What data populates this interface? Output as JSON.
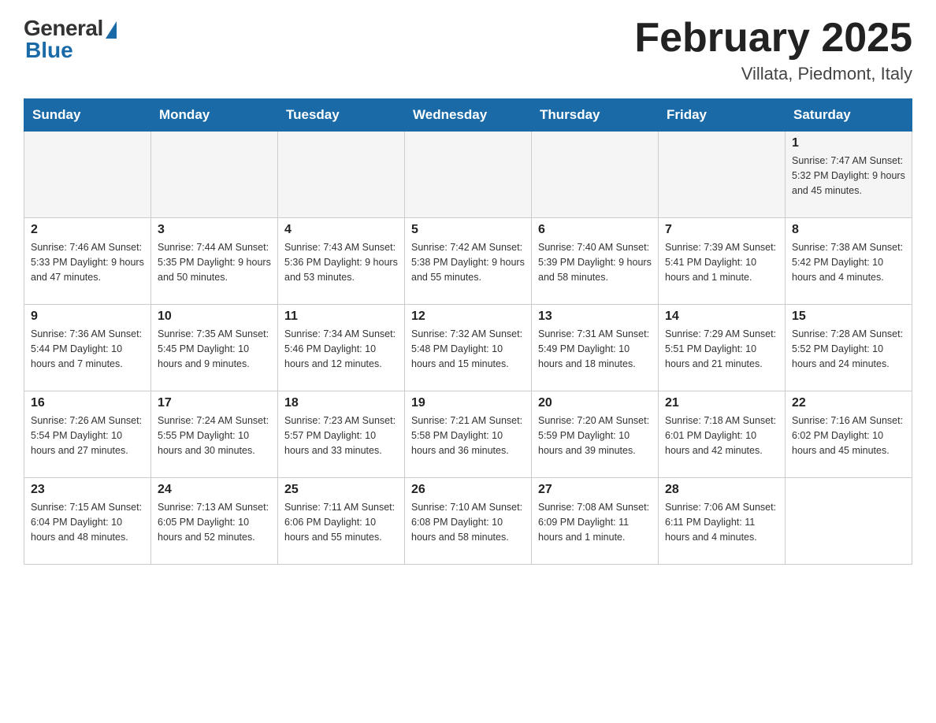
{
  "header": {
    "logo_general": "General",
    "logo_blue": "Blue",
    "month_title": "February 2025",
    "location": "Villata, Piedmont, Italy"
  },
  "weekdays": [
    "Sunday",
    "Monday",
    "Tuesday",
    "Wednesday",
    "Thursday",
    "Friday",
    "Saturday"
  ],
  "weeks": [
    [
      {
        "day": "",
        "info": ""
      },
      {
        "day": "",
        "info": ""
      },
      {
        "day": "",
        "info": ""
      },
      {
        "day": "",
        "info": ""
      },
      {
        "day": "",
        "info": ""
      },
      {
        "day": "",
        "info": ""
      },
      {
        "day": "1",
        "info": "Sunrise: 7:47 AM\nSunset: 5:32 PM\nDaylight: 9 hours and 45 minutes."
      }
    ],
    [
      {
        "day": "2",
        "info": "Sunrise: 7:46 AM\nSunset: 5:33 PM\nDaylight: 9 hours and 47 minutes."
      },
      {
        "day": "3",
        "info": "Sunrise: 7:44 AM\nSunset: 5:35 PM\nDaylight: 9 hours and 50 minutes."
      },
      {
        "day": "4",
        "info": "Sunrise: 7:43 AM\nSunset: 5:36 PM\nDaylight: 9 hours and 53 minutes."
      },
      {
        "day": "5",
        "info": "Sunrise: 7:42 AM\nSunset: 5:38 PM\nDaylight: 9 hours and 55 minutes."
      },
      {
        "day": "6",
        "info": "Sunrise: 7:40 AM\nSunset: 5:39 PM\nDaylight: 9 hours and 58 minutes."
      },
      {
        "day": "7",
        "info": "Sunrise: 7:39 AM\nSunset: 5:41 PM\nDaylight: 10 hours and 1 minute."
      },
      {
        "day": "8",
        "info": "Sunrise: 7:38 AM\nSunset: 5:42 PM\nDaylight: 10 hours and 4 minutes."
      }
    ],
    [
      {
        "day": "9",
        "info": "Sunrise: 7:36 AM\nSunset: 5:44 PM\nDaylight: 10 hours and 7 minutes."
      },
      {
        "day": "10",
        "info": "Sunrise: 7:35 AM\nSunset: 5:45 PM\nDaylight: 10 hours and 9 minutes."
      },
      {
        "day": "11",
        "info": "Sunrise: 7:34 AM\nSunset: 5:46 PM\nDaylight: 10 hours and 12 minutes."
      },
      {
        "day": "12",
        "info": "Sunrise: 7:32 AM\nSunset: 5:48 PM\nDaylight: 10 hours and 15 minutes."
      },
      {
        "day": "13",
        "info": "Sunrise: 7:31 AM\nSunset: 5:49 PM\nDaylight: 10 hours and 18 minutes."
      },
      {
        "day": "14",
        "info": "Sunrise: 7:29 AM\nSunset: 5:51 PM\nDaylight: 10 hours and 21 minutes."
      },
      {
        "day": "15",
        "info": "Sunrise: 7:28 AM\nSunset: 5:52 PM\nDaylight: 10 hours and 24 minutes."
      }
    ],
    [
      {
        "day": "16",
        "info": "Sunrise: 7:26 AM\nSunset: 5:54 PM\nDaylight: 10 hours and 27 minutes."
      },
      {
        "day": "17",
        "info": "Sunrise: 7:24 AM\nSunset: 5:55 PM\nDaylight: 10 hours and 30 minutes."
      },
      {
        "day": "18",
        "info": "Sunrise: 7:23 AM\nSunset: 5:57 PM\nDaylight: 10 hours and 33 minutes."
      },
      {
        "day": "19",
        "info": "Sunrise: 7:21 AM\nSunset: 5:58 PM\nDaylight: 10 hours and 36 minutes."
      },
      {
        "day": "20",
        "info": "Sunrise: 7:20 AM\nSunset: 5:59 PM\nDaylight: 10 hours and 39 minutes."
      },
      {
        "day": "21",
        "info": "Sunrise: 7:18 AM\nSunset: 6:01 PM\nDaylight: 10 hours and 42 minutes."
      },
      {
        "day": "22",
        "info": "Sunrise: 7:16 AM\nSunset: 6:02 PM\nDaylight: 10 hours and 45 minutes."
      }
    ],
    [
      {
        "day": "23",
        "info": "Sunrise: 7:15 AM\nSunset: 6:04 PM\nDaylight: 10 hours and 48 minutes."
      },
      {
        "day": "24",
        "info": "Sunrise: 7:13 AM\nSunset: 6:05 PM\nDaylight: 10 hours and 52 minutes."
      },
      {
        "day": "25",
        "info": "Sunrise: 7:11 AM\nSunset: 6:06 PM\nDaylight: 10 hours and 55 minutes."
      },
      {
        "day": "26",
        "info": "Sunrise: 7:10 AM\nSunset: 6:08 PM\nDaylight: 10 hours and 58 minutes."
      },
      {
        "day": "27",
        "info": "Sunrise: 7:08 AM\nSunset: 6:09 PM\nDaylight: 11 hours and 1 minute."
      },
      {
        "day": "28",
        "info": "Sunrise: 7:06 AM\nSunset: 6:11 PM\nDaylight: 11 hours and 4 minutes."
      },
      {
        "day": "",
        "info": ""
      }
    ]
  ]
}
